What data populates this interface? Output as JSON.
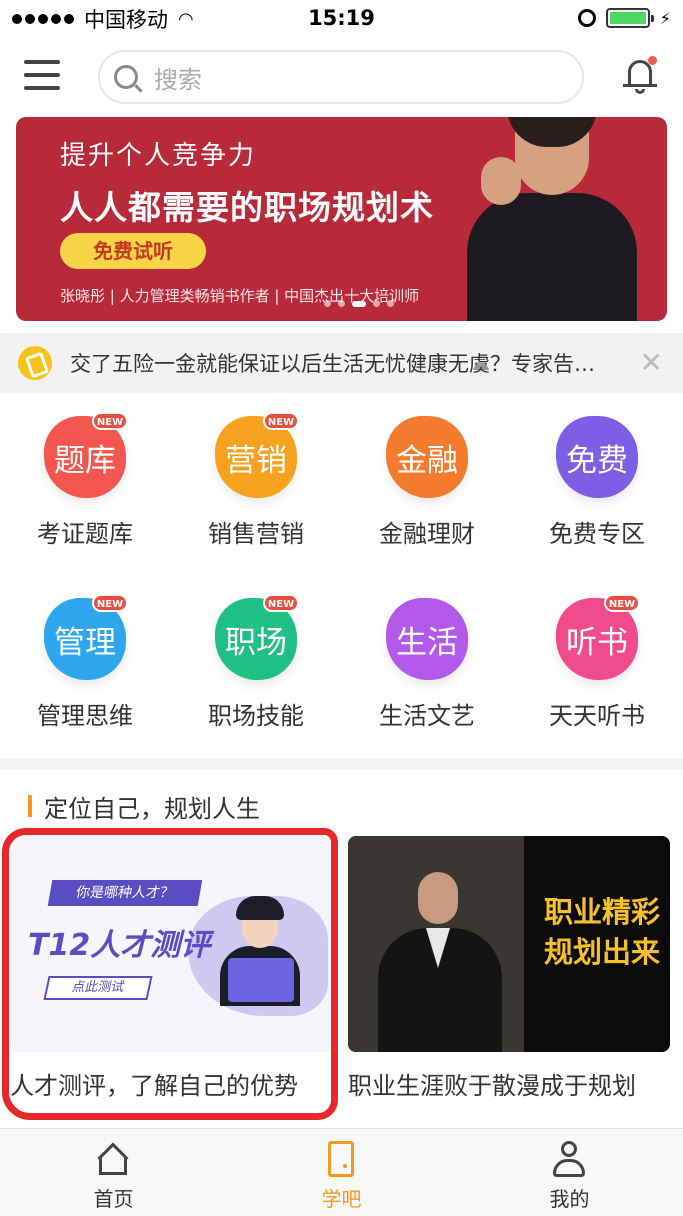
{
  "status_bar": {
    "carrier": "中国移动",
    "time": "15:19"
  },
  "search": {
    "placeholder": "搜索"
  },
  "banner": {
    "line1": "提升个人竞争力",
    "line2": "人人都需要的职场规划术",
    "button": "免费试听",
    "author": "张晓彤 | 人力管理类畅销书作者 | 中国杰出十大培训师"
  },
  "notice": {
    "text": "交了五险一金就能保证以后生活无忧健康无虞？专家告…",
    "close": "✕"
  },
  "categories": [
    {
      "icon_text": "题库",
      "label": "考证题库",
      "new": "NEW",
      "color": "#f2564e"
    },
    {
      "icon_text": "营销",
      "label": "销售营销",
      "new": "NEW",
      "color": "#f7a21e"
    },
    {
      "icon_text": "金融",
      "label": "金融理财",
      "new": "",
      "color": "#f47b2e"
    },
    {
      "icon_text": "免费",
      "label": "免费专区",
      "new": "",
      "color": "#7d5fe6"
    },
    {
      "icon_text": "管理",
      "label": "管理思维",
      "new": "NEW",
      "color": "#2ea6ee"
    },
    {
      "icon_text": "职场",
      "label": "职场技能",
      "new": "NEW",
      "color": "#1fbf86"
    },
    {
      "icon_text": "生活",
      "label": "生活文艺",
      "new": "",
      "color": "#b259ea"
    },
    {
      "icon_text": "听书",
      "label": "天天听书",
      "new": "NEW",
      "color": "#f04b8a"
    }
  ],
  "section": {
    "title": "定位自己，规划人生"
  },
  "cards": [
    {
      "title": "人才测评，了解自己的优势",
      "image_tag": "你是哪种人才？",
      "image_main": "T12人才测评",
      "image_button": "点此测试"
    },
    {
      "title": "职业生涯败于散漫成于规划",
      "image_text": "职业精彩规划出来"
    }
  ],
  "tabbar": [
    {
      "label": "首页",
      "icon": "home-icon"
    },
    {
      "label": "学吧",
      "icon": "learn-icon",
      "active": true
    },
    {
      "label": "我的",
      "icon": "profile-icon"
    }
  ],
  "colors": {
    "accent": "#f39a1e",
    "banner_bg": "#b8293a",
    "annotation": "#e8272a"
  }
}
